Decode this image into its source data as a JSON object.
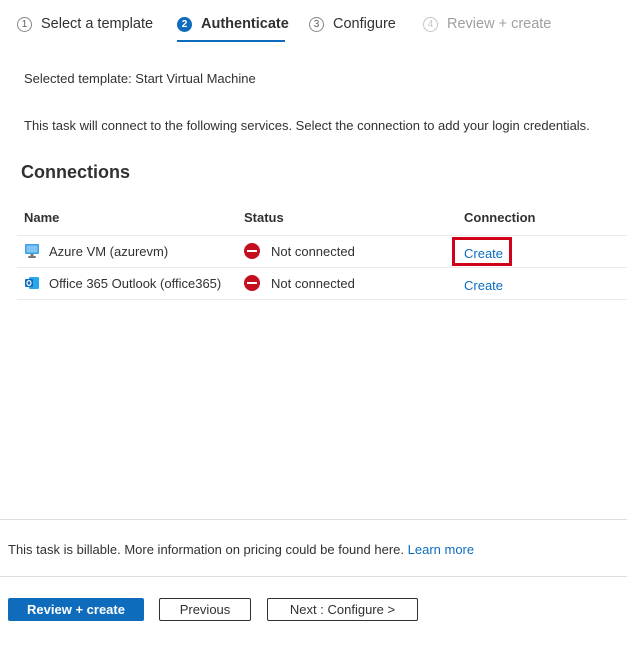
{
  "wizard": {
    "steps": [
      {
        "num": "1",
        "label": "Select a template",
        "state": "complete"
      },
      {
        "num": "2",
        "label": "Authenticate",
        "state": "active"
      },
      {
        "num": "3",
        "label": "Configure",
        "state": "pending"
      },
      {
        "num": "4",
        "label": "Review + create",
        "state": "disabled"
      }
    ]
  },
  "main": {
    "selected_template": "Selected template: Start Virtual Machine",
    "description": "This task will connect to the following services. Select the connection to add your login credentials.",
    "section_title": "Connections",
    "table": {
      "headers": [
        "Name",
        "Status",
        "Connection"
      ],
      "rows": [
        {
          "name": "Azure VM (azurevm)",
          "icon": "azure-vm-icon",
          "status": "Not connected",
          "action": "Create"
        },
        {
          "name": "Office 365 Outlook (office365)",
          "icon": "outlook-icon",
          "status": "Not connected",
          "action": "Create"
        }
      ]
    }
  },
  "footer": {
    "billing_text": "This task is billable. More information on pricing could be found here.",
    "learn_more": "Learn more",
    "buttons": {
      "review_create": "Review + create",
      "previous": "Previous",
      "next": "Next : Configure >"
    }
  },
  "colors": {
    "accent": "#0f6cbd",
    "error": "#c50f1f",
    "highlight": "#d0021b"
  }
}
